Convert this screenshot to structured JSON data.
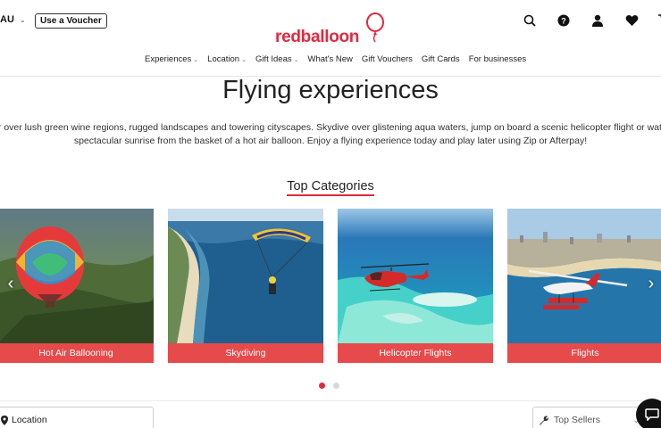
{
  "header": {
    "region_label": "AU",
    "voucher_button": "Use a Voucher",
    "logo_text": "redballoon",
    "icons": [
      "search-icon",
      "help-icon",
      "account-icon",
      "wishlist-heart-icon",
      "cart-icon"
    ],
    "help_glyph": "?"
  },
  "nav": {
    "items": [
      {
        "label": "Experiences",
        "dropdown": true
      },
      {
        "label": "Location",
        "dropdown": true
      },
      {
        "label": "Gift Ideas",
        "dropdown": true
      },
      {
        "label": "What's New",
        "dropdown": false
      },
      {
        "label": "Gift Vouchers",
        "dropdown": false
      },
      {
        "label": "Gift Cards",
        "dropdown": false
      },
      {
        "label": "For businesses",
        "dropdown": false
      }
    ]
  },
  "hero": {
    "title": "Flying experiences",
    "description_line1": "Soar over lush green wine regions, rugged landscapes and towering cityscapes. Skydive over glistening aqua waters, jump on board a scenic helicopter flight or watch a",
    "description_line2": "spectacular sunrise from the basket of a hot air balloon. Enjoy a flying experience today and play later using Zip or Afterpay!"
  },
  "categories": {
    "heading": "Top Categories",
    "items": [
      {
        "label": "Hot Air Ballooning"
      },
      {
        "label": "Skydiving"
      },
      {
        "label": "Helicopter Flights"
      },
      {
        "label": "Flights"
      }
    ],
    "carousel": {
      "page_count": 2,
      "active_page": 1
    }
  },
  "filters": {
    "location_label": "Location",
    "sort_value": "Top Sellers"
  },
  "colors": {
    "brand_red": "#e2293f",
    "card_label_bg": "#e64a4a"
  }
}
